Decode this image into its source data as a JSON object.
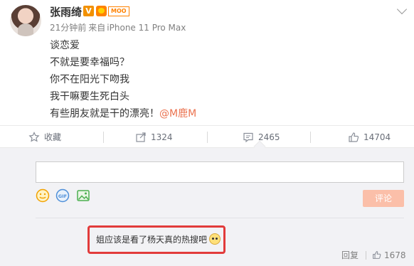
{
  "post": {
    "username": "张雨绮",
    "v_badge": "V",
    "vip_tag": "MOO",
    "time": "21分钟前",
    "source_prefix": "来自",
    "device": "iPhone 11 Pro Max",
    "lines": [
      "谈恋爱",
      "不就是要幸福吗？",
      "你不在阳光下吻我",
      "我干嘛要生死白头"
    ],
    "last_line_text": "有些朋友就是干的漂亮！",
    "mention": "@M鹿M"
  },
  "actions": {
    "favorite_label": "收藏",
    "share_count": "1324",
    "comment_count": "2465",
    "like_count": "14704"
  },
  "comment_box": {
    "placeholder": "",
    "submit_label": "评论"
  },
  "comment": {
    "text": "姐应该是看了杨天真的热搜吧",
    "reply_label": "回复",
    "like_count": "1678"
  },
  "colors": {
    "mention": "#eb7350",
    "highlight_border": "#e23b3b",
    "submit_bg": "#fbbfa9"
  },
  "icons": [
    "star-icon",
    "share-icon",
    "comment-icon",
    "thumbs-up-icon",
    "emoji-icon",
    "gif-icon",
    "image-icon",
    "cat-emoji-icon"
  ]
}
